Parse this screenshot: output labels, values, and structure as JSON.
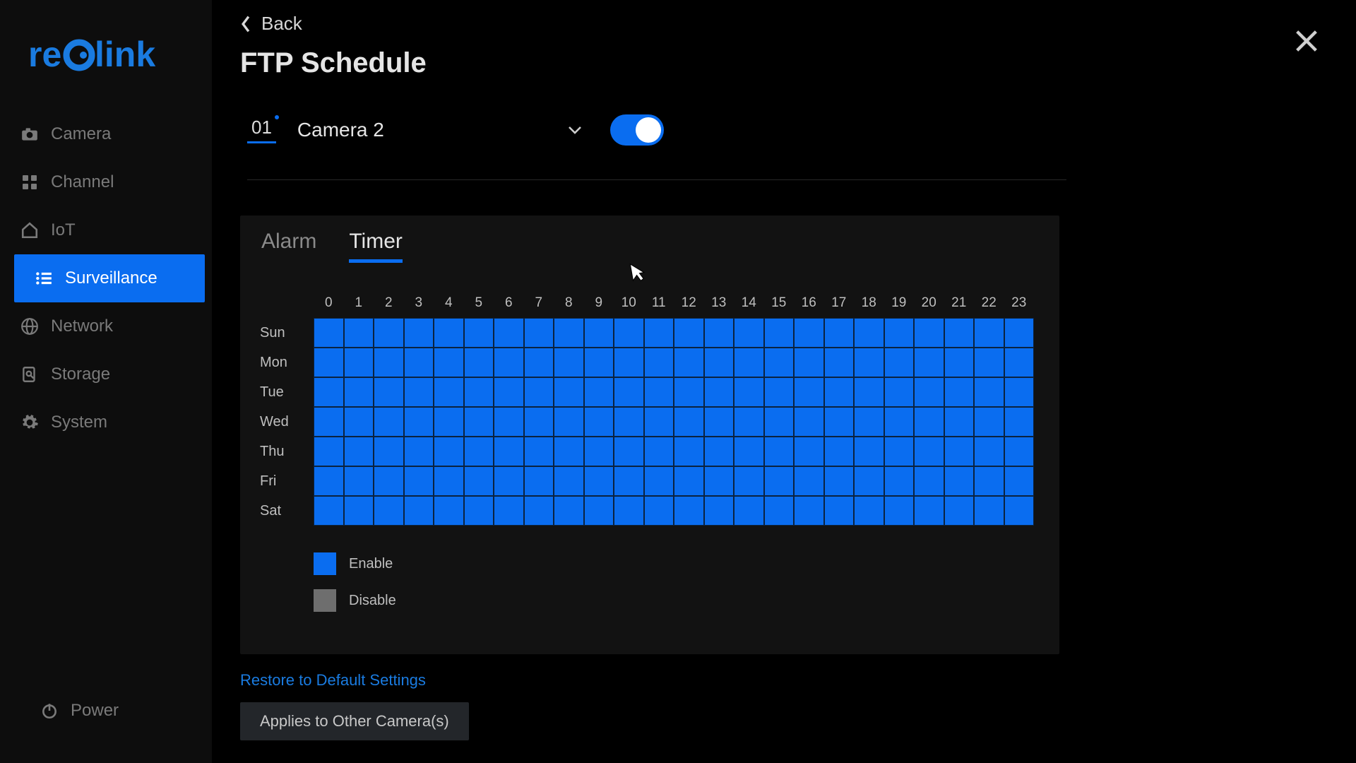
{
  "brand": "reolink",
  "sidebar": {
    "items": [
      {
        "label": "Camera",
        "icon": "camera-icon"
      },
      {
        "label": "Channel",
        "icon": "grid-icon"
      },
      {
        "label": "IoT",
        "icon": "home-icon"
      },
      {
        "label": "Surveillance",
        "icon": "list-icon",
        "active": true
      },
      {
        "label": "Network",
        "icon": "globe-icon"
      },
      {
        "label": "Storage",
        "icon": "search-doc-icon"
      },
      {
        "label": "System",
        "icon": "gear-icon"
      }
    ],
    "power_label": "Power"
  },
  "header": {
    "back_label": "Back",
    "title": "FTP Schedule"
  },
  "camera": {
    "channel_number": "01",
    "name": "Camera 2",
    "enabled": true
  },
  "tabs": [
    {
      "label": "Alarm",
      "active": false
    },
    {
      "label": "Timer",
      "active": true
    }
  ],
  "schedule": {
    "hours": [
      "0",
      "1",
      "2",
      "3",
      "4",
      "5",
      "6",
      "7",
      "8",
      "9",
      "10",
      "11",
      "12",
      "13",
      "14",
      "15",
      "16",
      "17",
      "18",
      "19",
      "20",
      "21",
      "22",
      "23"
    ],
    "days": [
      "Sun",
      "Mon",
      "Tue",
      "Wed",
      "Thu",
      "Fri",
      "Sat"
    ],
    "all_enabled": true
  },
  "legend": {
    "enable_label": "Enable",
    "disable_label": "Disable"
  },
  "actions": {
    "restore_label": "Restore to Default Settings",
    "apply_label": "Applies to Other Camera(s)"
  }
}
